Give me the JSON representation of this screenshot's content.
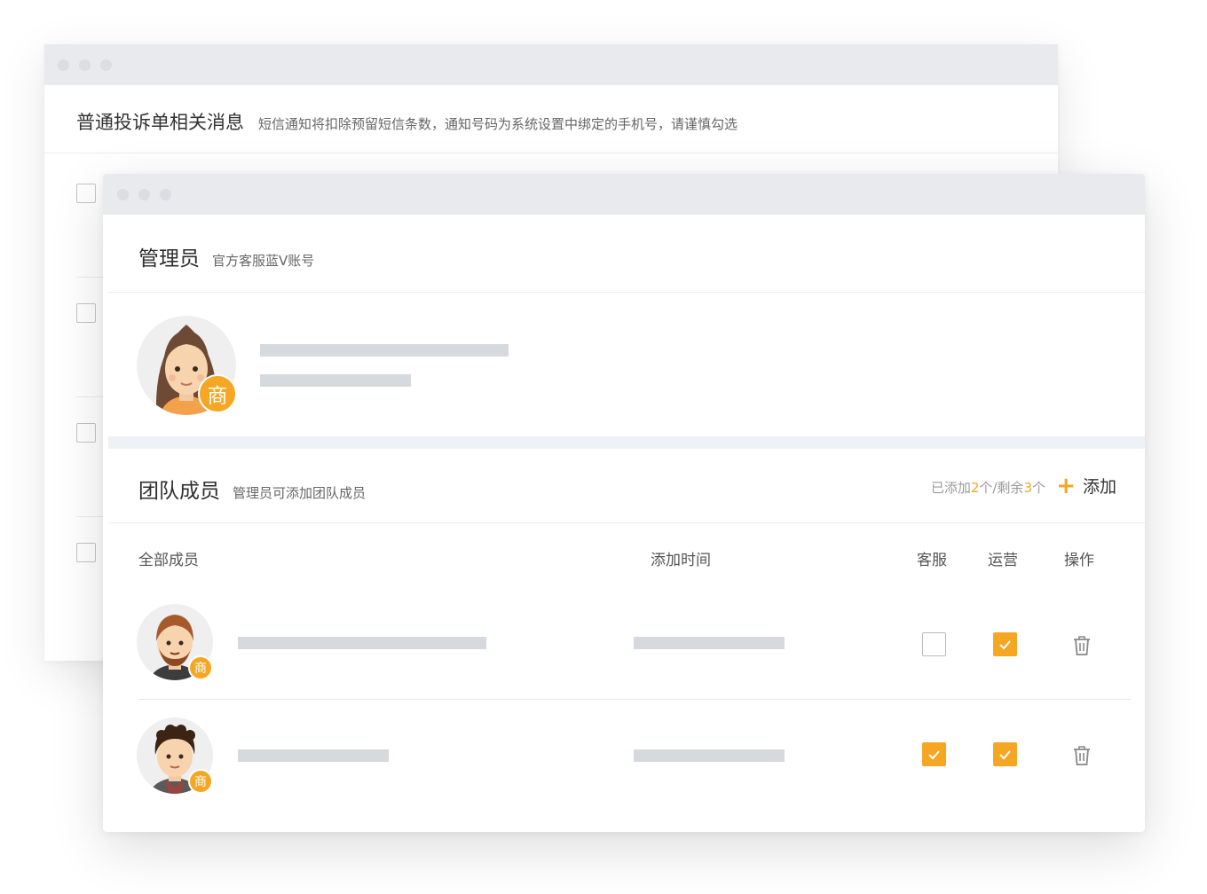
{
  "colors": {
    "accent": "#f5a623",
    "placeholder": "#d6d9de",
    "titlebar": "#e8eaed"
  },
  "back_window": {
    "title": "普通投诉单相关消息",
    "note": "短信通知将扣除预留短信条数，通知号码为系统设置中绑定的手机号，请谨慎勾选"
  },
  "admin": {
    "title": "管理员",
    "note": "官方客服蓝V账号",
    "avatar_icon": "female-avatar-icon",
    "badge": "商"
  },
  "team": {
    "title": "团队成员",
    "note": "管理员可添加团队成员",
    "count_prefix": "已添加",
    "added": "2",
    "count_mid": "个/剩余",
    "remaining": "3",
    "count_suffix": "个",
    "add_label": "添加",
    "headers": {
      "members": "全部成员",
      "time": "添加时间",
      "service": "客服",
      "ops": "运营",
      "action": "操作"
    },
    "rows": [
      {
        "badge": "商",
        "avatar_icon": "bearded-male-avatar-icon",
        "service_checked": false,
        "ops_checked": true
      },
      {
        "badge": "商",
        "avatar_icon": "curly-male-avatar-icon",
        "service_checked": true,
        "ops_checked": true
      }
    ]
  }
}
